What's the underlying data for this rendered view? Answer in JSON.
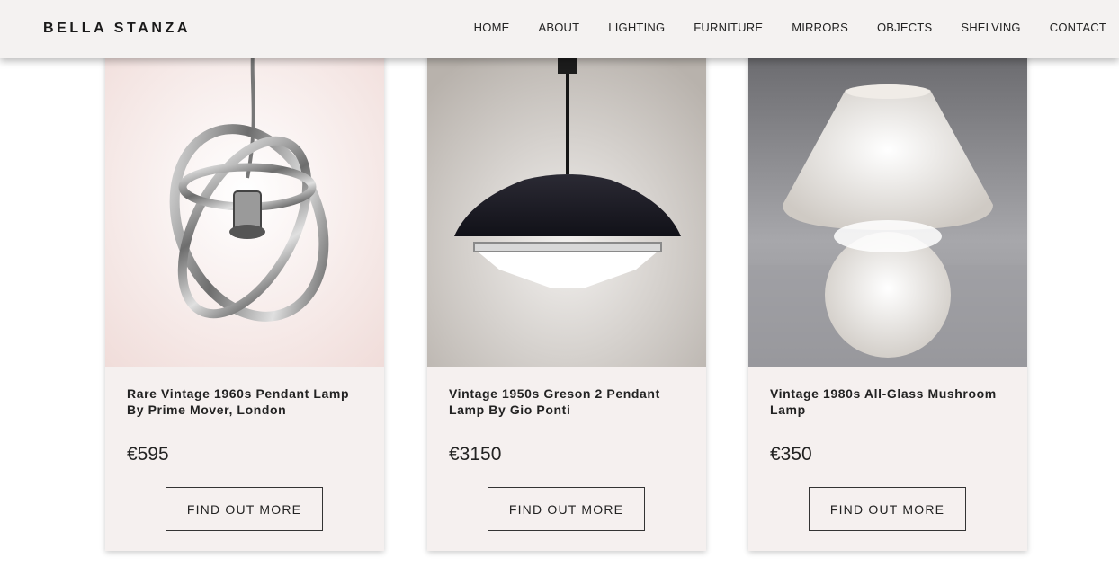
{
  "brand": {
    "name": "BELLA STANZA"
  },
  "nav": [
    "HOME",
    "ABOUT",
    "LIGHTING",
    "FURNITURE",
    "MIRRORS",
    "OBJECTS",
    "SHELVING",
    "CONTACT"
  ],
  "products": [
    {
      "title": "Rare Vintage 1960s Pendant Lamp By Prime Mover, London",
      "price": "€595",
      "button": "FIND OUT MORE"
    },
    {
      "title": "Vintage 1950s Greson 2 Pendant Lamp By Gio Ponti",
      "price": "€3150",
      "button": "FIND OUT MORE"
    },
    {
      "title": "Vintage 1980s All-Glass Mushroom Lamp",
      "price": "€350",
      "button": "FIND OUT MORE"
    }
  ],
  "colors": {
    "header_bg": "#f4f2f1",
    "card_bg": "#f5f0ef",
    "text": "#222222"
  }
}
